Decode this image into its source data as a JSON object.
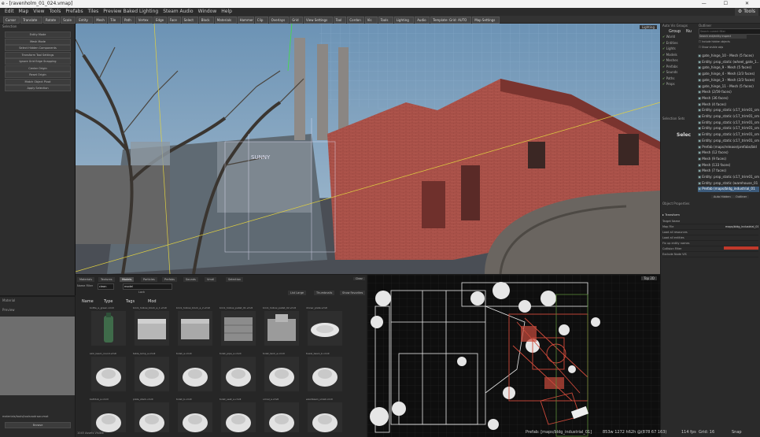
{
  "window": {
    "title": "e - [ravenholm_01_024.vmap]",
    "controls": "— ☐ ✕"
  },
  "menu": [
    "Edit",
    "Map",
    "View",
    "Tools",
    "Prefabs",
    "Tiles",
    "Preview Baked Lighting",
    "Steam Audio",
    "Window",
    "Help"
  ],
  "toolbar": {
    "tools_label": "Tools",
    "buttons": [
      "Cursor",
      "Translate",
      "Rotate",
      "Scale",
      "Entity",
      "Mesh",
      "Tile",
      "Path",
      "Vertex",
      "Edge",
      "Face",
      "Select",
      "Block",
      "Materials",
      "Hammer",
      "Clip",
      "Overlays",
      "Grid",
      "View Settings",
      "Tool",
      "Cordon",
      "Vis",
      "Tools",
      "Lighting",
      "Audio",
      "Template: Grid: AUTO",
      "Map Settings"
    ]
  },
  "left_panel": {
    "header": "Selection",
    "buttons": [
      "Entity Mode",
      "Mesh Mode",
      "Select Hidden Components",
      "Transform Tool Settings",
      "Ignore Grid Edge Snapping",
      "Center Origin",
      "Reset Origin",
      "Match Object Pivot",
      "Apply Selection"
    ],
    "bottom_header": "Material",
    "bottom_label": "Preview",
    "material_name": "materials/tools/toolsnodraw.vmat",
    "browse_label": "Browse"
  },
  "viewport3d": {
    "label": "Lighting",
    "sign_text": "SUNNY"
  },
  "asset_browser": {
    "tabs": [
      "Materials",
      "Textures",
      "Models",
      "Particles",
      "Prefabs",
      "Sounds",
      "Vmdl",
      "Selection"
    ],
    "search_label": "Name Filter",
    "search_value": "clean",
    "filter_value": "model",
    "columns": [
      "Name",
      "Type",
      "Tags",
      "Mod"
    ],
    "buttons": [
      "List Large",
      "Thumbnails",
      "Show Favorites",
      "Clear"
    ],
    "lock_label": "Lock",
    "status": "1045 Assets Visible",
    "items": [
      {
        "name": "bottle_a_green.vmdl"
      },
      {
        "name": "brick_hollow_block_a_1.vmdl"
      },
      {
        "name": "brick_hollow_block_a_2.vmdl"
      },
      {
        "name": "brick_hollow_pallet_01.vmdl"
      },
      {
        "name": "brick_hollow_pallet_02.vmdl"
      },
      {
        "name": "dinner_plate.vmdl"
      },
      {
        "name": "sink_basin_round.vmdl"
      },
      {
        "name": "table_lamp_a.vmdl"
      },
      {
        "name": "toilet_a.vmdl"
      },
      {
        "name": "toilet_pipe_a.vmdl"
      },
      {
        "name": "toilet_tank_a.vmdl"
      },
      {
        "name": "towel_basin_b.vmdl"
      },
      {
        "name": "bathtub_a.vmdl"
      },
      {
        "name": "plate_stack.vmdl"
      },
      {
        "name": "toilet_b.vmdl"
      },
      {
        "name": "toilet_seat_a.vmdl"
      },
      {
        "name": "urinal_a.vmdl"
      },
      {
        "name": "washbasin_small.vmdl"
      }
    ]
  },
  "map_view": {
    "statusbar": "Prefab: [maps/bldg_industrial_01",
    "label": "Top 2D"
  },
  "statusbar": {
    "left": "Prefab: [maps/bldg_industrial_01]",
    "coords": "853w 1272 h62h @(878 67 163)",
    "fps": "114 fps",
    "grid": "Grid: 16",
    "snap": "Snap"
  },
  "right_panel": {
    "header_left": "Auto Vis Groups",
    "header_right": "Outliner",
    "group_cols": [
      "Group",
      "Nu"
    ],
    "outliner_search_placeholder": "Search current filter",
    "include_hidden_label": "Include hidden objects",
    "show_visible_label": "Show visible objs",
    "search_button": "Search ent/entity inspect",
    "groups": [
      "World",
      "Entities",
      "Lights",
      "Models",
      "Meshes",
      "Prefabs",
      "Sounds",
      "Paths",
      "Props"
    ],
    "outliner_items": [
      "gate_hinge_10 - Mesh (5 faces)",
      "Entity: prop_static (wheel_gate_1...)",
      "gate_hinge_9 - Mesh (5 faces)",
      "gate_hinge_4 - Mesh (2/3 faces)",
      "gate_hinge_3 - Mesh (2/3 faces)",
      "gate_hinge_11 - Mesh (5 faces)",
      "Mesh (2/59 faces)",
      "Mesh (36 faces)",
      "Mesh (4 faces)",
      "Entity: prop_static (c17_trim01_sm",
      "Entity: prop_static (c17_trim01_sm",
      "Entity: prop_static (c17_trim01_sm",
      "Entity: prop_static (c17_trim01_sm",
      "Entity: prop_static (c17_trim01_sm",
      "Entity: prop_static (c17_trim01_sm",
      "Prefab (maps/release/prefabs/bld",
      "Mesh (12 faces)",
      "Mesh (9 faces)",
      "Mesh (133 faces)",
      "Mesh (7 faces)",
      "Entity: prop_static (c17_trim01_sm",
      "Entity: prop_static (warehouse_01",
      "Prefab (maps/bldg_industrial_01"
    ],
    "selection_sets_label": "Selection Sets",
    "selection_label": "Selec",
    "outliner_buttons": [
      "Auto Hidden",
      "Outliner"
    ],
    "props_header": "Object Properties",
    "props_tab": "Transform",
    "props": [
      {
        "name": "Target Name",
        "value": ""
      },
      {
        "name": "Map File",
        "value": "maps/bldg_industrial_01"
      },
      {
        "name": "Load all resources",
        "value": ""
      },
      {
        "name": "Load all entities",
        "value": ""
      },
      {
        "name": "Fix up entity names",
        "value": ""
      },
      {
        "name": "Collision Filter",
        "value": ""
      },
      {
        "name": "Exclude Node VIS",
        "value": ""
      }
    ],
    "colors": {
      "accent": "#c0392b",
      "selected": "#3c5a7a"
    }
  }
}
